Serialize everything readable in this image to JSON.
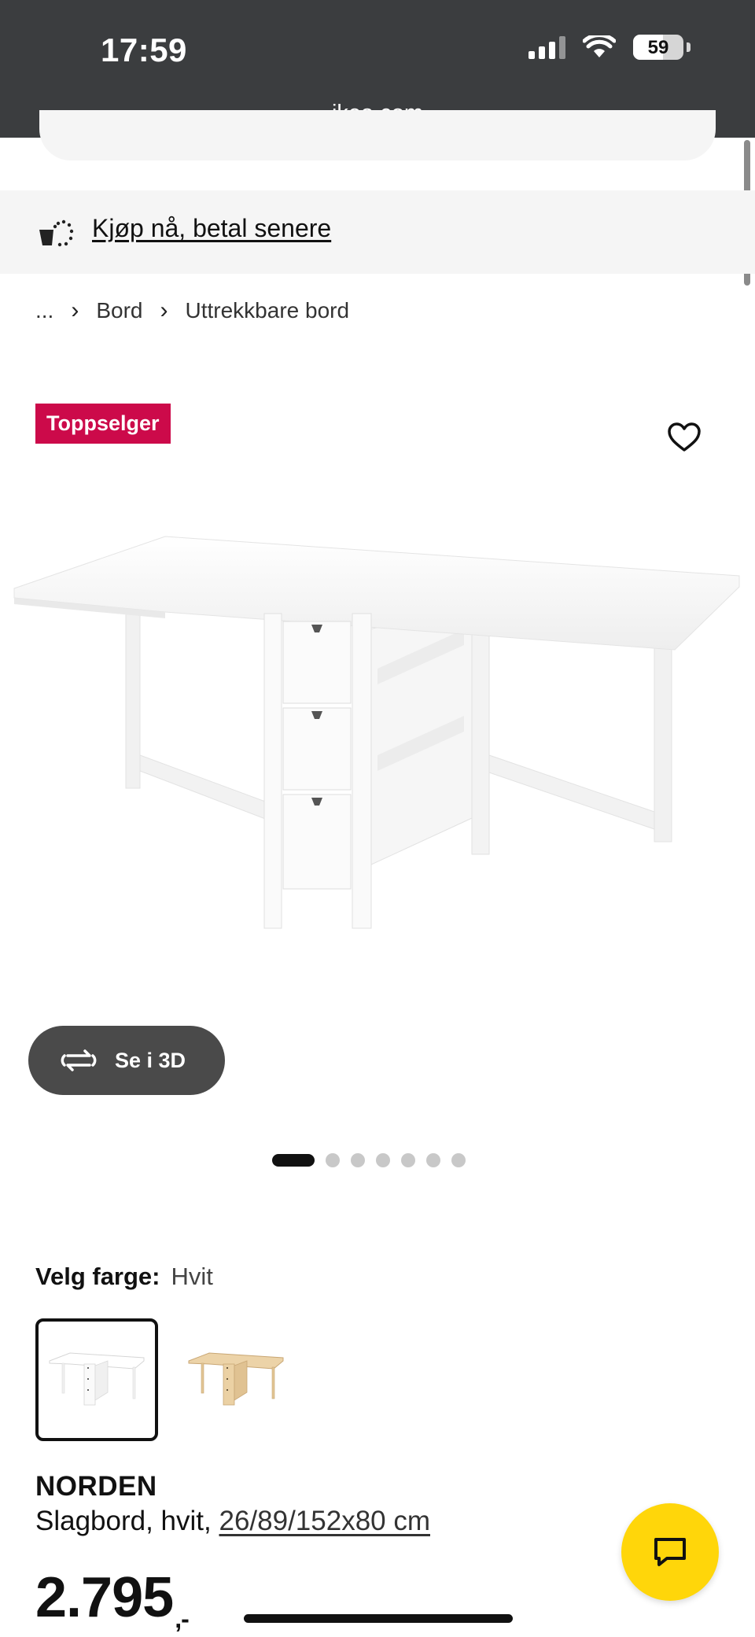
{
  "status_bar": {
    "time": "17:59",
    "battery": "59"
  },
  "browser": {
    "url": "ikea.com"
  },
  "banner": {
    "label": "Kjøp nå, betal senere"
  },
  "breadcrumb": {
    "items": [
      "...",
      "Bord",
      "Uttrekkbare bord"
    ]
  },
  "product": {
    "badge": "Toppselger",
    "view_3d_label": "Se i 3D",
    "image_count": 7,
    "active_image_index": 0,
    "color_label": "Velg farge:",
    "color_value": "Hvit",
    "colors": [
      "Hvit",
      "Bjørk"
    ],
    "name": "NORDEN",
    "description": "Slagbord, hvit,",
    "dimensions": "26/89/152x80 cm",
    "price": "2.795",
    "price_suffix": ",-"
  },
  "colors": {
    "badge_bg": "#cc0a4a",
    "chat_button": "#ffd60a",
    "topbar": "#3b3d3f"
  },
  "icons": {
    "heart": "heart-icon",
    "rotate": "rotate-3d-icon",
    "chat": "chat-icon",
    "pay_later": "pay-later-icon"
  }
}
